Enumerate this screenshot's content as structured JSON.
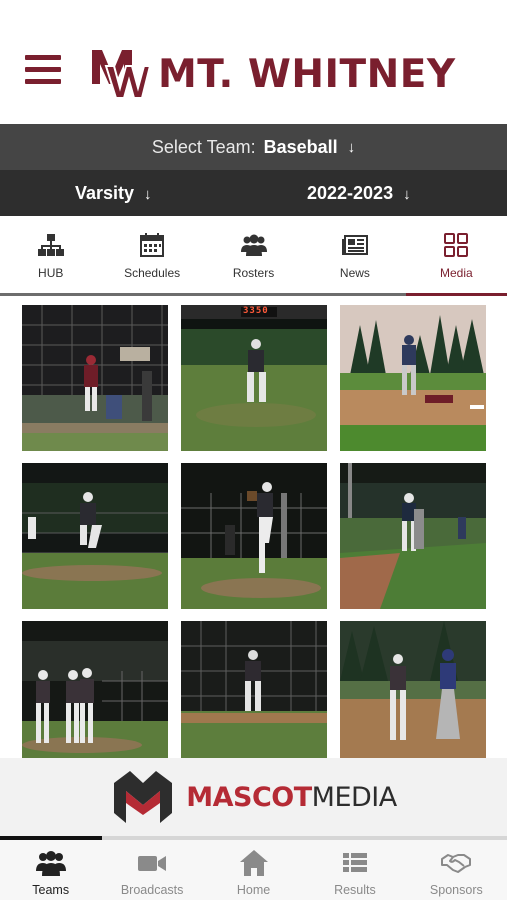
{
  "header": {
    "school_name": "MT. WHITNEY",
    "logo_icon": "mw-monogram-logo",
    "brand_color": "#7a1f2e"
  },
  "team_selector": {
    "label": "Select Team:",
    "value": "Baseball",
    "arrow": "↓"
  },
  "filters": {
    "level": "Varsity",
    "season": "2022-2023",
    "arrow": "↓"
  },
  "subnav": {
    "items": [
      {
        "label": "HUB",
        "icon": "org-chart-icon"
      },
      {
        "label": "Schedules",
        "icon": "calendar-icon"
      },
      {
        "label": "Rosters",
        "icon": "people-icon"
      },
      {
        "label": "News",
        "icon": "newspaper-icon"
      },
      {
        "label": "Media",
        "icon": "grid-icon",
        "active": true
      }
    ]
  },
  "media": {
    "photos": [
      {
        "scene": "batter-at-plate-night"
      },
      {
        "scene": "pitcher-under-scoreboard",
        "scoreboard_text": "3350"
      },
      {
        "scene": "runner-sliding-into-base"
      },
      {
        "scene": "pitcher-windup-1"
      },
      {
        "scene": "pitcher-windup-2"
      },
      {
        "scene": "infielders-on-dirt"
      },
      {
        "scene": "players-meeting-at-mound"
      },
      {
        "scene": "fielder-behind-fence"
      },
      {
        "scene": "players-at-first-base"
      }
    ]
  },
  "sponsor": {
    "name_part1": "MASCOT",
    "name_part2": "MEDIA",
    "logo_icon": "mascot-media-m-logo"
  },
  "tabbar": {
    "tabs": [
      {
        "label": "Teams",
        "icon": "people-icon",
        "active": true
      },
      {
        "label": "Broadcasts",
        "icon": "video-camera-icon"
      },
      {
        "label": "Home",
        "icon": "home-icon"
      },
      {
        "label": "Results",
        "icon": "list-icon"
      },
      {
        "label": "Sponsors",
        "icon": "handshake-icon"
      }
    ]
  }
}
